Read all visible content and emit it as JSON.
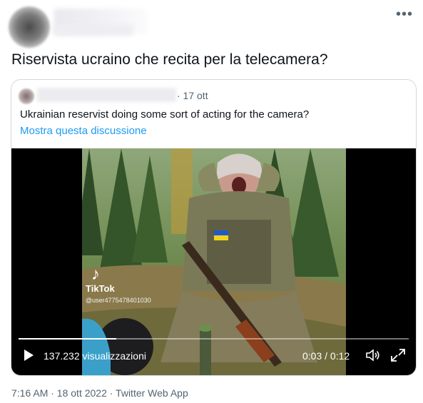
{
  "header": {
    "more_icon": "more-horizontal-icon"
  },
  "tweet": {
    "text": "Riservista ucraino che recita per la telecamera?"
  },
  "quote": {
    "date": "· 17 ott",
    "text": "Ukrainian reservist doing some sort of acting for the camera?",
    "show_thread": "Mostra questa discussione"
  },
  "video": {
    "watermark": "TikTok",
    "watermark_user": "@user4775478401030",
    "views": "137.232 visualizzazioni",
    "time": "0:03 / 0:12",
    "progress": 0.25,
    "colors": {
      "accent_link": "#1d9bf0",
      "muted": "#536471"
    }
  },
  "meta": {
    "timestamp": "7:16 AM · 18 ott 2022 · Twitter Web App"
  }
}
